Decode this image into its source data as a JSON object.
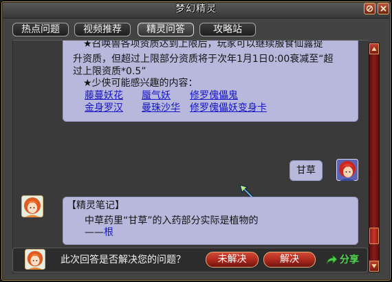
{
  "window": {
    "title": "梦幻精灵"
  },
  "tabs": [
    {
      "label": "热点问题",
      "active": false
    },
    {
      "label": "视频推荐",
      "active": false
    },
    {
      "label": "精灵问答",
      "active": true
    },
    {
      "label": "攻略站",
      "active": false
    }
  ],
  "answer1": {
    "lines": [
      "★召唤兽各项资质达到上限后，玩家可以继续服食仙露提",
      "升资质，但超过上限部分资质将于次年1月1日0:00衰减至“超",
      "过上限资质*0.5”"
    ],
    "interest_heading": "★少侠可能感兴趣的内容：",
    "links": [
      "藤蔓妖花",
      "蜃气妖",
      "修罗傀儡鬼",
      "金身罗汉",
      "曼珠沙华",
      "修罗傀儡妖变身卡"
    ]
  },
  "question": {
    "text": "甘草"
  },
  "answer2": {
    "heading": "【精灵笔记】",
    "body": "中草药里“甘草”的入药部分实际是植物的",
    "dash": "——",
    "link": "根"
  },
  "feedback": {
    "prompt": "此次回答是否解决您的问题？",
    "unresolved_label": "未解决",
    "resolved_label": "解决",
    "share_label": "分享"
  },
  "colors": {
    "bubble": "#b7b8db",
    "link": "#1616c4",
    "share": "#4fd24f",
    "button": "#b02a1e",
    "scrollbar": "#8a1a1a",
    "frame_gold": "#a08652"
  },
  "icons": {
    "title_extra": "circle-slash-icon",
    "close": "close-icon",
    "cursor": "wand-cursor-icon",
    "share": "share-icon",
    "scroll_up": "arrow-up-icon",
    "scroll_down": "arrow-down-icon"
  }
}
